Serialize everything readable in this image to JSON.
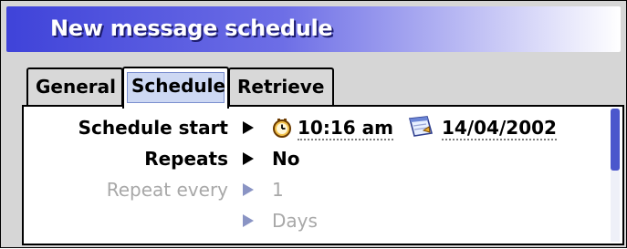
{
  "window": {
    "title": "New message schedule"
  },
  "tabs": [
    {
      "label": "General",
      "active": false
    },
    {
      "label": "Schedule",
      "active": true
    },
    {
      "label": "Retrieve",
      "active": false
    }
  ],
  "fields": {
    "schedule_start": {
      "label": "Schedule start",
      "time": "10:16 am",
      "date": "14/04/2002",
      "icons": [
        "clock-icon",
        "calendar-icon"
      ]
    },
    "repeats": {
      "label": "Repeats",
      "value": "No"
    },
    "repeat_every": {
      "label": "Repeat every",
      "value": "1",
      "enabled": false
    },
    "repeat_unit": {
      "value": "Days",
      "enabled": false
    }
  },
  "colors": {
    "title_start": "#3f43d9",
    "title_end": "#ffffff",
    "tab_highlight": "#cdd8f3",
    "scroll_thumb": "#4b57cc",
    "disabled_text": "#a8a8a8"
  }
}
